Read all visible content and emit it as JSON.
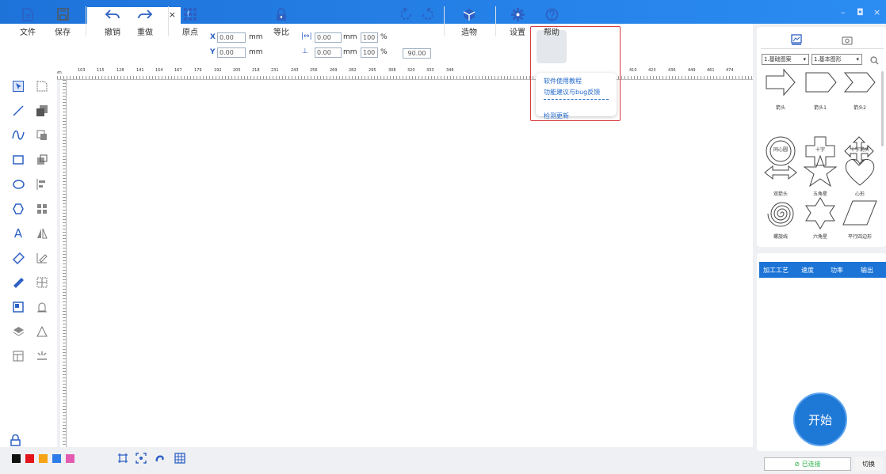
{
  "titlebar": {
    "tab_close": "×",
    "tab_add": "+",
    "minimize": "–",
    "maximize": "◘",
    "close": "×"
  },
  "toolbar": {
    "file": "文件",
    "save": "保存",
    "undo": "撤销",
    "redo": "重做",
    "origin": "原点",
    "x_label": "X",
    "y_label": "Y",
    "x_value": "0.00",
    "y_value": "0.00",
    "unit_mm": "mm",
    "ratio": "等比",
    "w_value": "0.00",
    "h_value": "0.00",
    "w_pct": "100",
    "h_pct": "100",
    "pct": "%",
    "rotate_value": "90.00",
    "object": "造物",
    "settings": "设置",
    "help": "帮助"
  },
  "help_menu": {
    "items": [
      "软件使用教程",
      "功能建议与bug反馈",
      "检测更新"
    ]
  },
  "ruler": {
    "h_ticks": [
      "103",
      "115",
      "128",
      "141",
      "154",
      "167",
      "179",
      "192",
      "205",
      "218",
      "231",
      "243",
      "256",
      "269",
      "282",
      "295",
      "308",
      "320",
      "333",
      "346",
      "410",
      "423",
      "436",
      "449",
      "461",
      "474"
    ]
  },
  "right_panel": {
    "category": "1.基础图案",
    "subcategory": "1.基本图形",
    "shapes": [
      {
        "label": "箭头",
        "icon": "arrow"
      },
      {
        "label": "箭头1",
        "icon": "arrow-pentagon"
      },
      {
        "label": "箭头2",
        "icon": "chevron-arrow"
      },
      {
        "label": "同心圆",
        "icon": "concentric-circles"
      },
      {
        "label": "十字",
        "icon": "cross"
      },
      {
        "label": "十字箭头",
        "icon": "cross-arrows"
      },
      {
        "label": "双箭头",
        "icon": "double-arrow"
      },
      {
        "label": "五角星",
        "icon": "five-star"
      },
      {
        "label": "心形",
        "icon": "heart"
      },
      {
        "label": "螺旋线",
        "icon": "spiral"
      },
      {
        "label": "六角星",
        "icon": "six-star"
      },
      {
        "label": "平行四边形",
        "icon": "parallelogram"
      }
    ]
  },
  "process_table": {
    "headers": [
      "加工工艺",
      "速度",
      "功率",
      "输出"
    ]
  },
  "start_label": "开始",
  "connection": {
    "status": "已连接",
    "switch_label": "切换"
  },
  "colors": {
    "accent": "#1e78d6",
    "palette": [
      "#111111",
      "#e3141b",
      "#f6a316",
      "#2e7ce8",
      "#e35bb0"
    ]
  }
}
